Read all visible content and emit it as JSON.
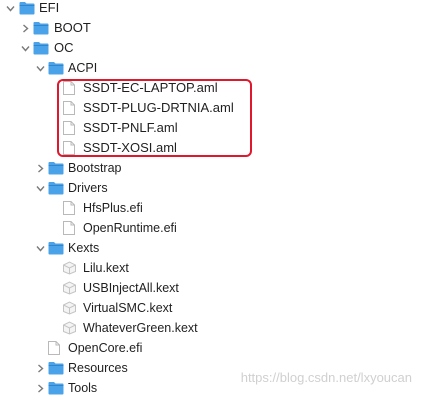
{
  "tree": {
    "efi": "EFI",
    "boot": "BOOT",
    "oc": "OC",
    "acpi": "ACPI",
    "acpi_files": [
      "SSDT-EC-LAPTOP.aml",
      "SSDT-PLUG-DRTNIA.aml",
      "SSDT-PNLF.aml",
      "SSDT-XOSI.aml"
    ],
    "bootstrap": "Bootstrap",
    "drivers": "Drivers",
    "driver_files": [
      "HfsPlus.efi",
      "OpenRuntime.efi"
    ],
    "kexts": "Kexts",
    "kext_files": [
      "Lilu.kext",
      "USBInjectAll.kext",
      "VirtualSMC.kext",
      "WhateverGreen.kext"
    ],
    "opencore": "OpenCore.efi",
    "resources": "Resources",
    "tools": "Tools"
  },
  "watermark": "https://blog.csdn.net/lxyoucan",
  "colors": {
    "folder": "#4aa3e8",
    "highlight": "#e0182e"
  },
  "icons": {
    "folder": "folder-icon",
    "file": "file-icon",
    "kext": "kext-bundle-icon"
  }
}
